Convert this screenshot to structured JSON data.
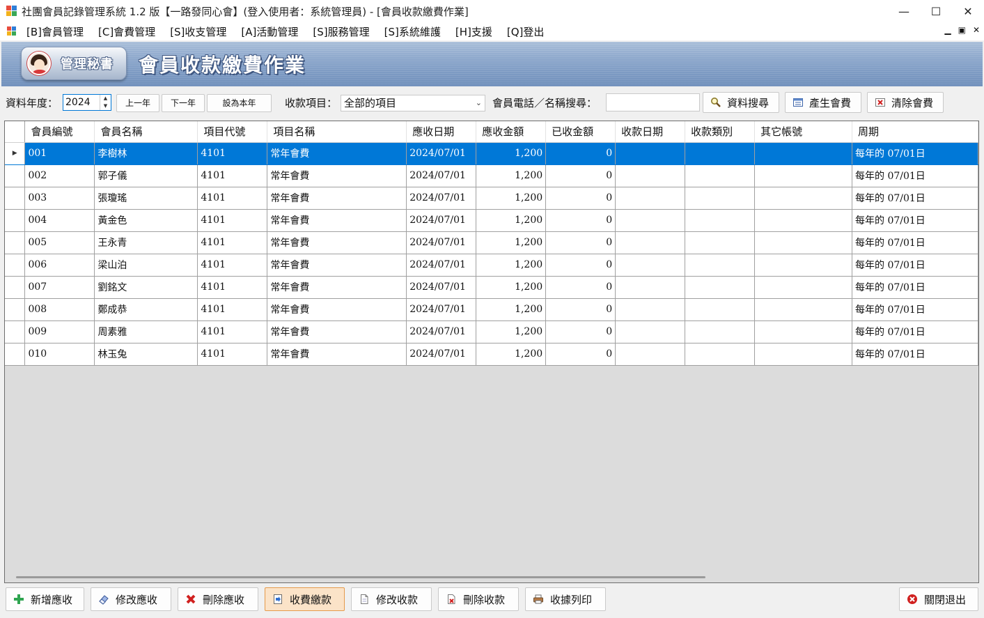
{
  "window": {
    "title": "社團會員記錄管理系統 1.2 版【一路發同心會】(登入使用者：系統管理員) - [會員收款繳費作業]",
    "minimize": "—",
    "maximize": "☐",
    "close": "✕"
  },
  "menu": {
    "items": [
      "[B]會員管理",
      "[C]會費管理",
      "[S]收支管理",
      "[A]活動管理",
      "[S]服務管理",
      "[S]系統維護",
      "[H]支援",
      "[Q]登出"
    ],
    "mdi_min": "▁",
    "mdi_restore": "▣",
    "mdi_close": "✕"
  },
  "banner": {
    "badge": "管理秘書",
    "title": "會員收款繳費作業"
  },
  "toolbar": {
    "year_label": "資料年度：",
    "year_value": "2024",
    "prev_year": "上一年",
    "next_year": "下一年",
    "set_this_year": "設為本年",
    "item_label": "收款項目：",
    "item_value": "全部的項目",
    "search_label": "會員電話／名稱搜尋：",
    "search_value": "",
    "search_button": "資料搜尋",
    "generate_button": "產生會費",
    "clear_button": "清除會費"
  },
  "grid": {
    "columns": [
      "會員編號",
      "會員名稱",
      "項目代號",
      "項目名稱",
      "應收日期",
      "應收金額",
      "已收金額",
      "收款日期",
      "收款類別",
      "其它帳號",
      "周期"
    ],
    "rows": [
      [
        "001",
        "李樹林",
        "4101",
        "常年會費",
        "2024/07/01",
        "1,200",
        "0",
        "",
        "",
        "",
        "每年的 07/01日"
      ],
      [
        "002",
        "郭子儀",
        "4101",
        "常年會費",
        "2024/07/01",
        "1,200",
        "0",
        "",
        "",
        "",
        "每年的 07/01日"
      ],
      [
        "003",
        "張瓊瑤",
        "4101",
        "常年會費",
        "2024/07/01",
        "1,200",
        "0",
        "",
        "",
        "",
        "每年的 07/01日"
      ],
      [
        "004",
        "黃金色",
        "4101",
        "常年會費",
        "2024/07/01",
        "1,200",
        "0",
        "",
        "",
        "",
        "每年的 07/01日"
      ],
      [
        "005",
        "王永青",
        "4101",
        "常年會費",
        "2024/07/01",
        "1,200",
        "0",
        "",
        "",
        "",
        "每年的 07/01日"
      ],
      [
        "006",
        "梁山泊",
        "4101",
        "常年會費",
        "2024/07/01",
        "1,200",
        "0",
        "",
        "",
        "",
        "每年的 07/01日"
      ],
      [
        "007",
        "劉銘文",
        "4101",
        "常年會費",
        "2024/07/01",
        "1,200",
        "0",
        "",
        "",
        "",
        "每年的 07/01日"
      ],
      [
        "008",
        "鄭成恭",
        "4101",
        "常年會費",
        "2024/07/01",
        "1,200",
        "0",
        "",
        "",
        "",
        "每年的 07/01日"
      ],
      [
        "009",
        "周素雅",
        "4101",
        "常年會費",
        "2024/07/01",
        "1,200",
        "0",
        "",
        "",
        "",
        "每年的 07/01日"
      ],
      [
        "010",
        "林玉兔",
        "4101",
        "常年會費",
        "2024/07/01",
        "1,200",
        "0",
        "",
        "",
        "",
        "每年的 07/01日"
      ]
    ],
    "selected_row": 0,
    "row_indicator": "▶"
  },
  "bottom": {
    "add": "新增應收",
    "edit": "修改應收",
    "delete": "刪除應收",
    "collect": "收費繳款",
    "edit_payment": "修改收款",
    "delete_payment": "刪除收款",
    "print_receipt": "收據列印",
    "exit": "關閉退出"
  },
  "colors": {
    "selection": "#0078d7",
    "banner": "#8ba6cb",
    "active_button": "#fbe3c8"
  }
}
